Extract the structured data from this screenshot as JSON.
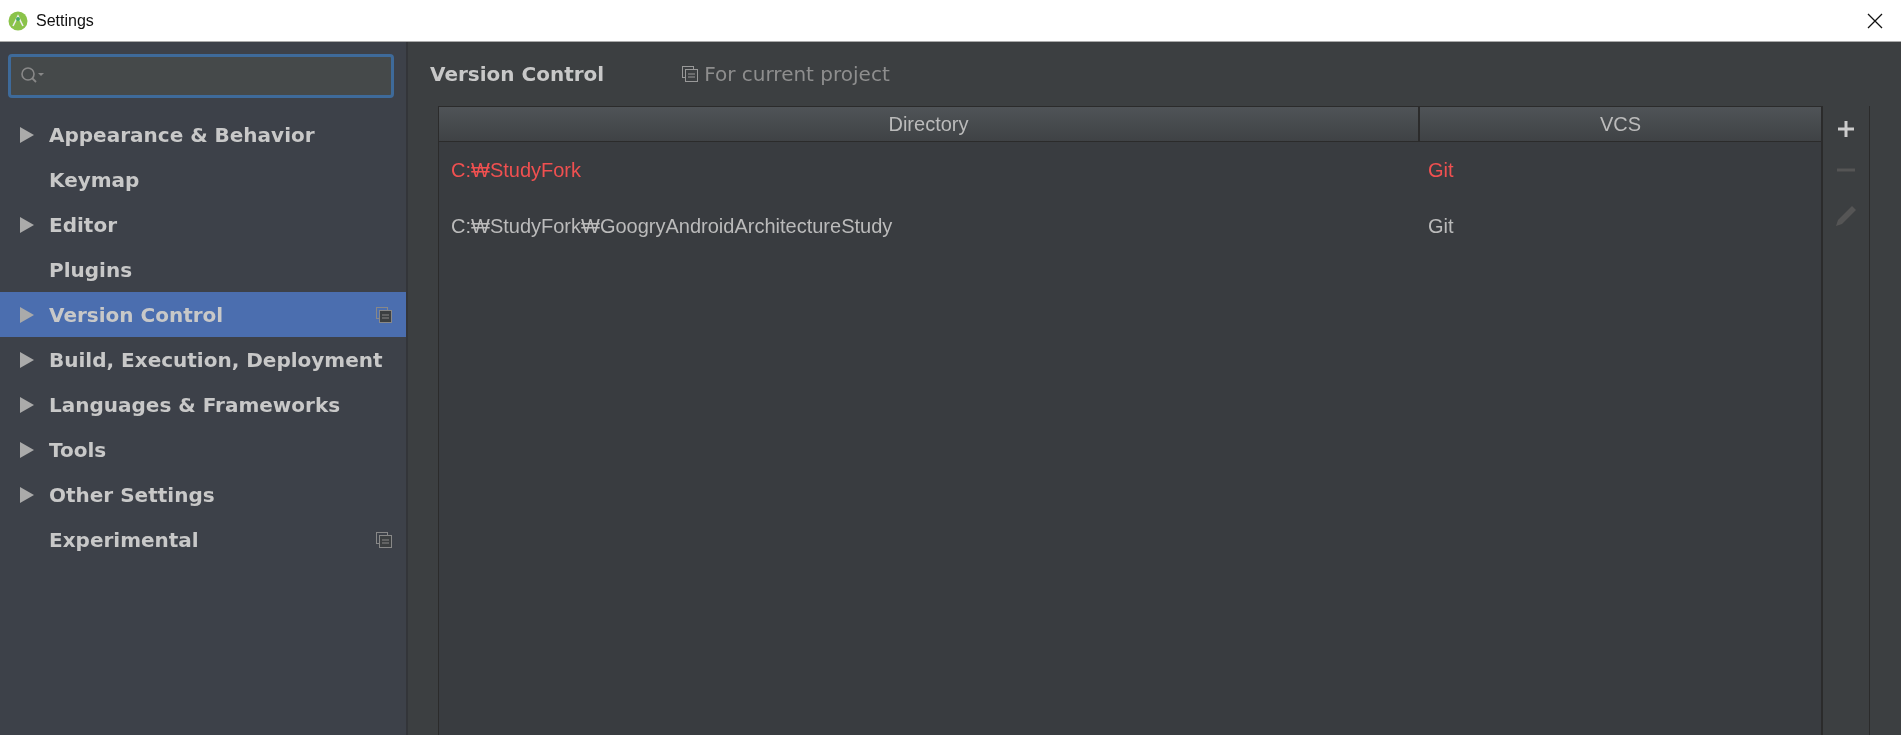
{
  "window": {
    "title": "Settings"
  },
  "sidebar": {
    "items": [
      {
        "label": "Appearance & Behavior",
        "expandable": true,
        "selected": false,
        "project_level": false
      },
      {
        "label": "Keymap",
        "expandable": false,
        "selected": false,
        "project_level": false
      },
      {
        "label": "Editor",
        "expandable": true,
        "selected": false,
        "project_level": false
      },
      {
        "label": "Plugins",
        "expandable": false,
        "selected": false,
        "project_level": false
      },
      {
        "label": "Version Control",
        "expandable": true,
        "selected": true,
        "project_level": true
      },
      {
        "label": "Build, Execution, Deployment",
        "expandable": true,
        "selected": false,
        "project_level": false
      },
      {
        "label": "Languages & Frameworks",
        "expandable": true,
        "selected": false,
        "project_level": false
      },
      {
        "label": "Tools",
        "expandable": true,
        "selected": false,
        "project_level": false
      },
      {
        "label": "Other Settings",
        "expandable": true,
        "selected": false,
        "project_level": false
      },
      {
        "label": "Experimental",
        "expandable": false,
        "selected": false,
        "project_level": true
      }
    ]
  },
  "panel": {
    "title": "Version Control",
    "scope": "For current project"
  },
  "table": {
    "columns": [
      "Directory",
      "VCS"
    ],
    "rows": [
      {
        "cells": [
          "C:₩StudyFork",
          "Git"
        ],
        "error": true
      },
      {
        "cells": [
          "C:₩StudyFork₩GoogryAndroidArchitectureStudy",
          "Git"
        ],
        "error": false
      }
    ]
  },
  "toolbar": [
    {
      "kind": "add",
      "disabled": false
    },
    {
      "kind": "remove",
      "disabled": true
    },
    {
      "kind": "edit",
      "disabled": true
    }
  ]
}
